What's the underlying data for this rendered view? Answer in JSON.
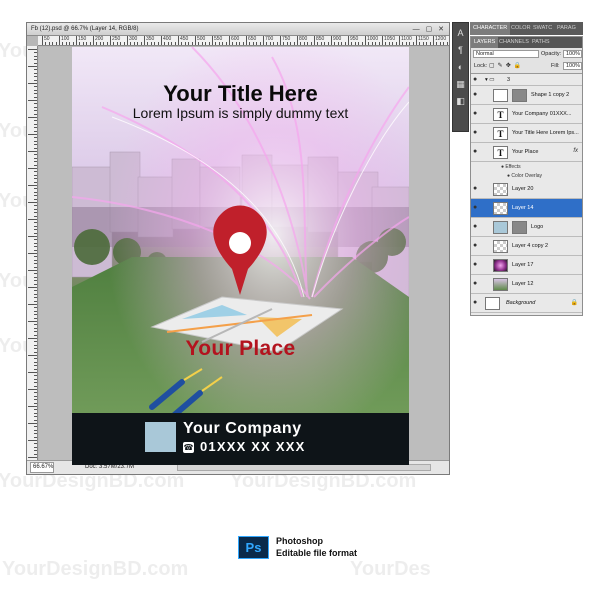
{
  "watermark": "YourDesignBD.com",
  "watermark_short": "YourDes",
  "document": {
    "title": "Fb (12).psd @ 66.7% (Layer 14, RGB/8)",
    "controls": "— ▢ ✕",
    "zoom": "66.67%",
    "doc_size": "Doc: 3.57M/23.7M",
    "ruler_labels": [
      "50",
      "100",
      "150",
      "200",
      "250",
      "300",
      "350",
      "400",
      "450",
      "500",
      "550",
      "600",
      "650",
      "700",
      "750",
      "800",
      "850",
      "900",
      "950",
      "1000",
      "1050",
      "1100",
      "1150",
      "1200"
    ]
  },
  "flyer": {
    "title": "Your Title Here",
    "subtitle": "Lorem Ipsum is simply dummy text",
    "place": "Your Place",
    "company": "Your Company",
    "phone": "01XXX XX XXX",
    "phone_icon": "phone-icon"
  },
  "panels": {
    "char_tabs": [
      "CHARACTER",
      "COLOR",
      "SWATC",
      "PARAG"
    ],
    "layer_tabs": [
      "LAYERS",
      "CHANNELS",
      "PATHS"
    ],
    "blend_mode": "Normal",
    "opacity_label": "Opacity:",
    "opacity_value": "100%",
    "lock_label": "Lock:",
    "fill_label": "Fill:",
    "fill_value": "100%",
    "group_name": "3",
    "layers": [
      {
        "name": "Shape 1 copy 2",
        "thumb": "shape"
      },
      {
        "name": "Your Company  01XXX...",
        "thumb": "text"
      },
      {
        "name": "Your Title Here Lorem Ips...",
        "thumb": "text"
      },
      {
        "name": "Your Place",
        "thumb": "text",
        "fx": "fx"
      },
      {
        "name": "Layer 20",
        "thumb": "checker"
      },
      {
        "name": "Layer 14",
        "thumb": "checker",
        "selected": true
      },
      {
        "name": "Logo",
        "thumb": "logo"
      },
      {
        "name": "Layer 4 copy 2",
        "thumb": "checker"
      },
      {
        "name": "Layer 17",
        "thumb": "pink"
      },
      {
        "name": "Layer 12",
        "thumb": "photo"
      },
      {
        "name": "Background",
        "thumb": "white"
      }
    ],
    "effects_label": "Effects",
    "color_overlay_label": "Color Overlay"
  },
  "format": {
    "icon": "Ps",
    "app": "Photoshop",
    "label": "Editable file format"
  },
  "colors": {
    "accent_blue": "#2f6fc8",
    "place_red": "#b3131e",
    "footer_dark": "#0e1418",
    "ps_blue": "#31a8ff"
  }
}
